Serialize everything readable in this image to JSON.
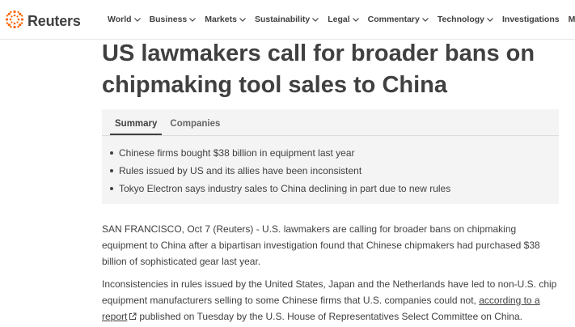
{
  "header": {
    "logo_text": "Reuters",
    "nav": [
      {
        "label": "World"
      },
      {
        "label": "Business"
      },
      {
        "label": "Markets"
      },
      {
        "label": "Sustainability"
      },
      {
        "label": "Legal"
      },
      {
        "label": "Commentary"
      },
      {
        "label": "Technology"
      },
      {
        "label": "Investigations"
      },
      {
        "label": "Mo"
      }
    ]
  },
  "article": {
    "headline": "US lawmakers call for broader bans on chipmaking tool sales to China",
    "tabs": [
      "Summary",
      "Companies"
    ],
    "summary": [
      "Chinese firms bought $38 billion in equipment last year",
      "Rules issued by US and its allies have been inconsistent",
      "Tokyo Electron says industry sales to China declining in part due to new rules"
    ],
    "p1": "SAN FRANCISCO, Oct 7 (Reuters) - U.S. lawmakers are calling for broader bans on chipmaking equipment to China after a bipartisan investigation found that Chinese chipmakers had purchased $38 billion of sophisticated gear last year.",
    "p2_before": "Inconsistencies in rules issued by the United States, Japan and the Netherlands have led to non-U.S. chip equipment manufacturers selling to some Chinese firms that U.S. companies could not,",
    "p2_link": "according to a report",
    "p2_after": "published on Tuesday by the U.S. House of Representatives Select Committee on China."
  },
  "colors": {
    "brand": "#fa6400",
    "text": "#404040"
  }
}
